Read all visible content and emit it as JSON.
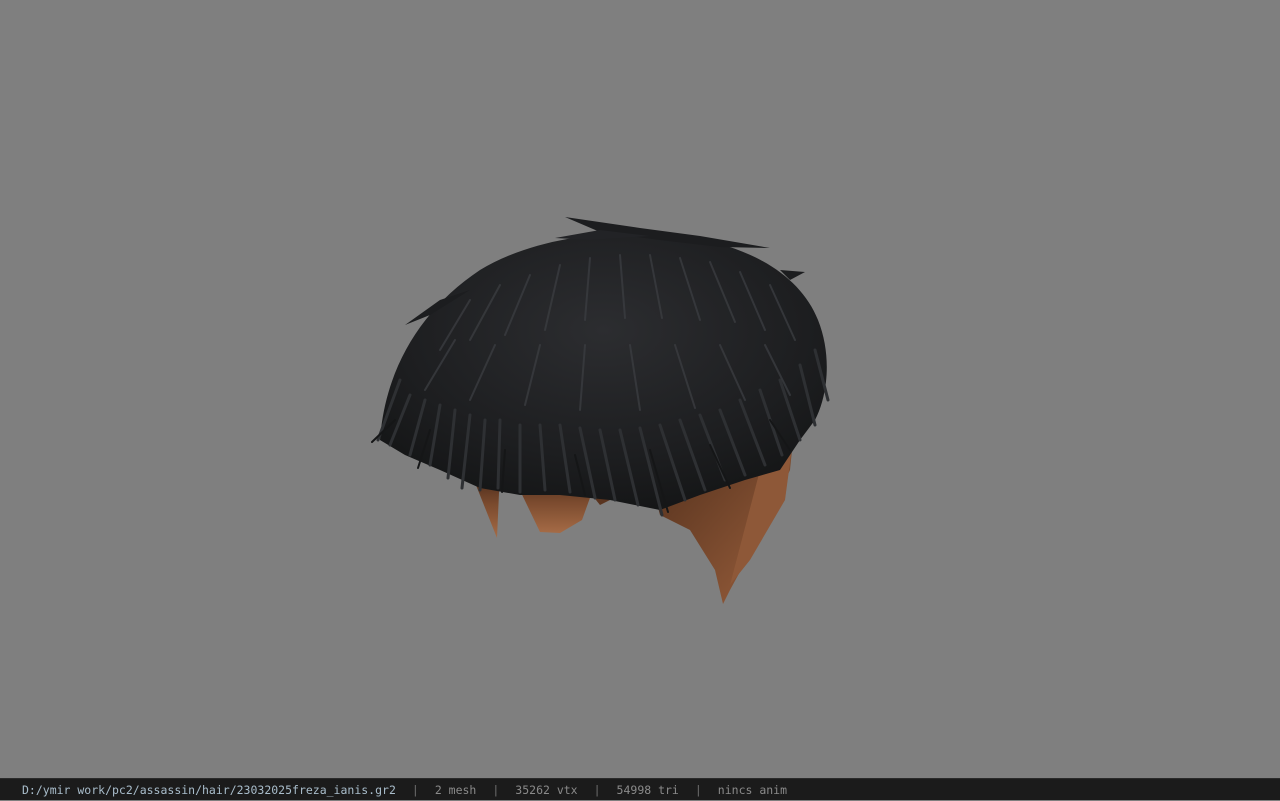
{
  "viewport": {
    "background": "#7f7f7f",
    "model": "hair-mesh",
    "hair_color": "#1e1f21",
    "skin_color": "#6b3f27"
  },
  "statusbar": {
    "path": "D:/ymir work/pc2/assassin/hair/23032025freza_ianis.gr2",
    "mesh": "2 mesh",
    "vtx": "35262 vtx",
    "tri": "54998 tri",
    "anim": "nincs anim",
    "separator": "|"
  }
}
